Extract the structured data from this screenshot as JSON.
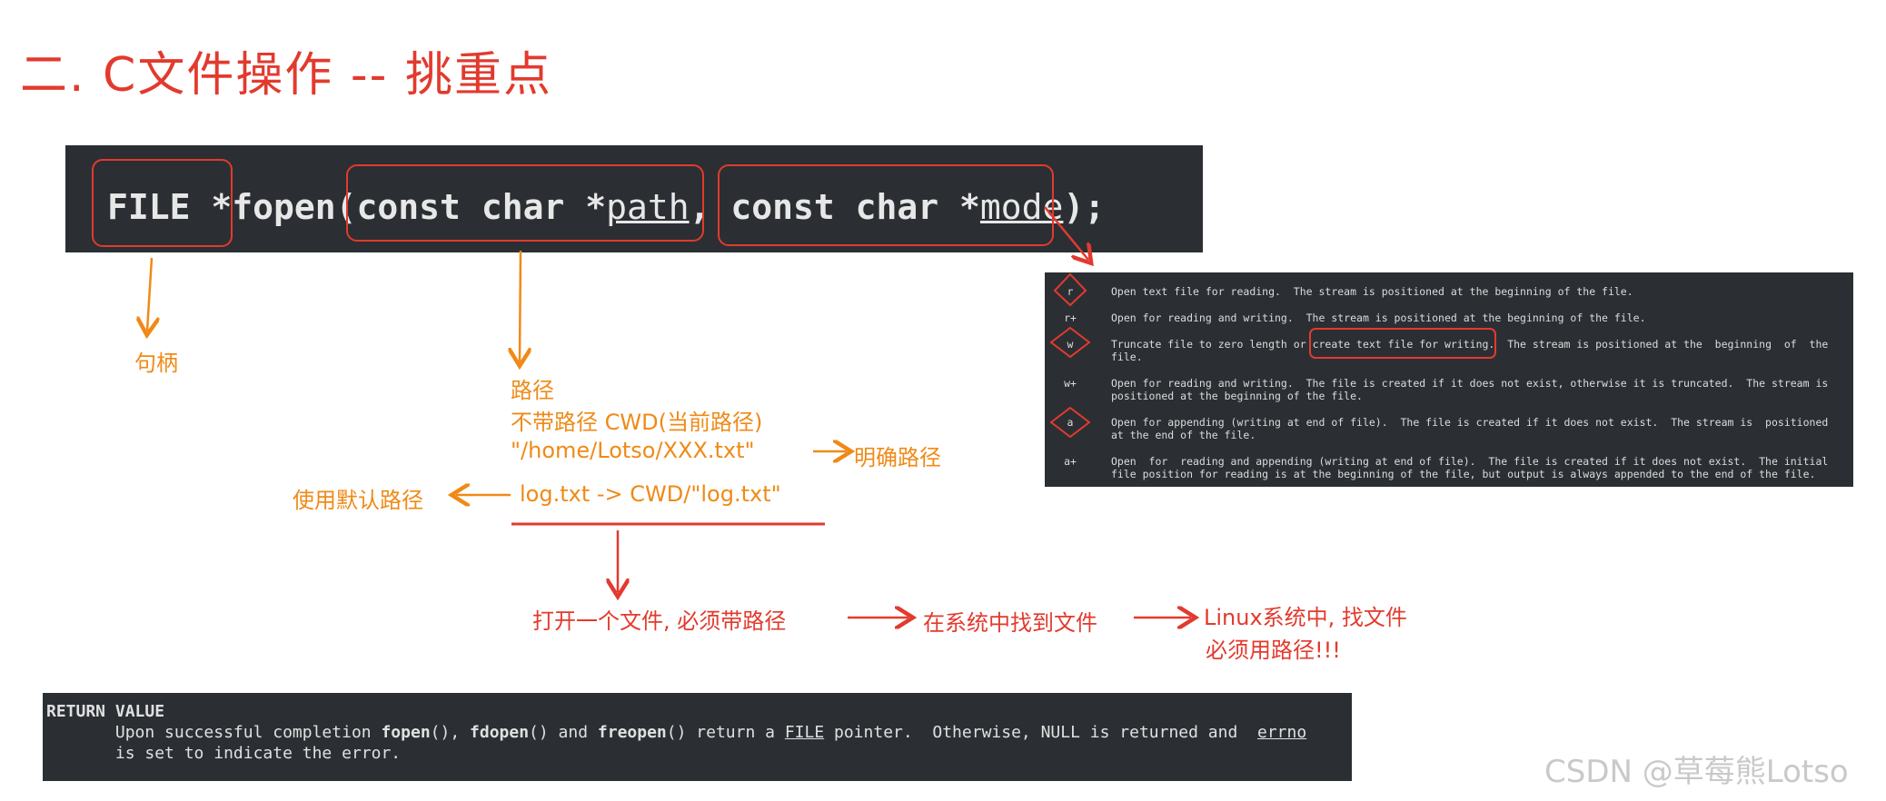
{
  "title": "二. C文件操作 -- 挑重点",
  "code": {
    "part1": "FILE",
    "part2": " *fopen(",
    "part3": "const char *",
    "path": "path",
    "part4": ", ",
    "part5": "const char *",
    "mode": "mode",
    "part6": ");"
  },
  "annotations": {
    "handle": "句柄",
    "path_title": "路径",
    "no_path": "不带路径 CWD(当前路径)",
    "abs_path": "\"/home/Lotso/XXX.txt\"",
    "explicit_path": "明确路径",
    "default_path": "使用默认路径",
    "log_txt": "log.txt -> CWD/\"log.txt\"",
    "open_file": "打开一个文件, 必须带路径",
    "find_in_system": "在系统中找到文件",
    "linux_line1": "Linux系统中, 找文件",
    "linux_line2": "必须用路径!!!"
  },
  "modes": [
    {
      "key": "r",
      "desc": "Open text file for reading.  The stream is positioned at the beginning of the file."
    },
    {
      "key": "r+",
      "desc": "Open for reading and writing.  The stream is positioned at the beginning of the file."
    },
    {
      "key": "w",
      "desc_a": "Truncate file to zero length or ",
      "desc_b": "create text file for writing.",
      "desc_c": "  The stream is positioned at the  beginning  of  the\nfile."
    },
    {
      "key": "w+",
      "desc": "Open for reading and writing.  The file is created if it does not exist, otherwise it is truncated.  The stream is\npositioned at the beginning of the file."
    },
    {
      "key": "a",
      "desc": "Open for appending (writing at end of file).  The file is created if it does not exist.  The stream is  positioned\nat the end of the file."
    },
    {
      "key": "a+",
      "desc": "Open  for  reading and appending (writing at end of file).  The file is created if it does not exist.  The initial\nfile position for reading is at the beginning of the file, but output is always appended to the end of the file."
    }
  ],
  "return_value": {
    "heading": "RETURN VALUE",
    "l1_a": "       Upon successful completion ",
    "fopen": "fopen",
    "l1_b": "(), ",
    "fdopen": "fdopen",
    "l1_c": "() and ",
    "freopen": "freopen",
    "l1_d": "() return a ",
    "file": "FILE",
    "l1_e": " pointer.  Otherwise, NULL is returned and  ",
    "errno": "errno",
    "l2": "       is set to indicate the error."
  },
  "watermark": "CSDN @草莓熊Lotso",
  "colors": {
    "red": "#e23a2e",
    "orange": "#ef8a17",
    "code_bg": "#2b2f33"
  }
}
